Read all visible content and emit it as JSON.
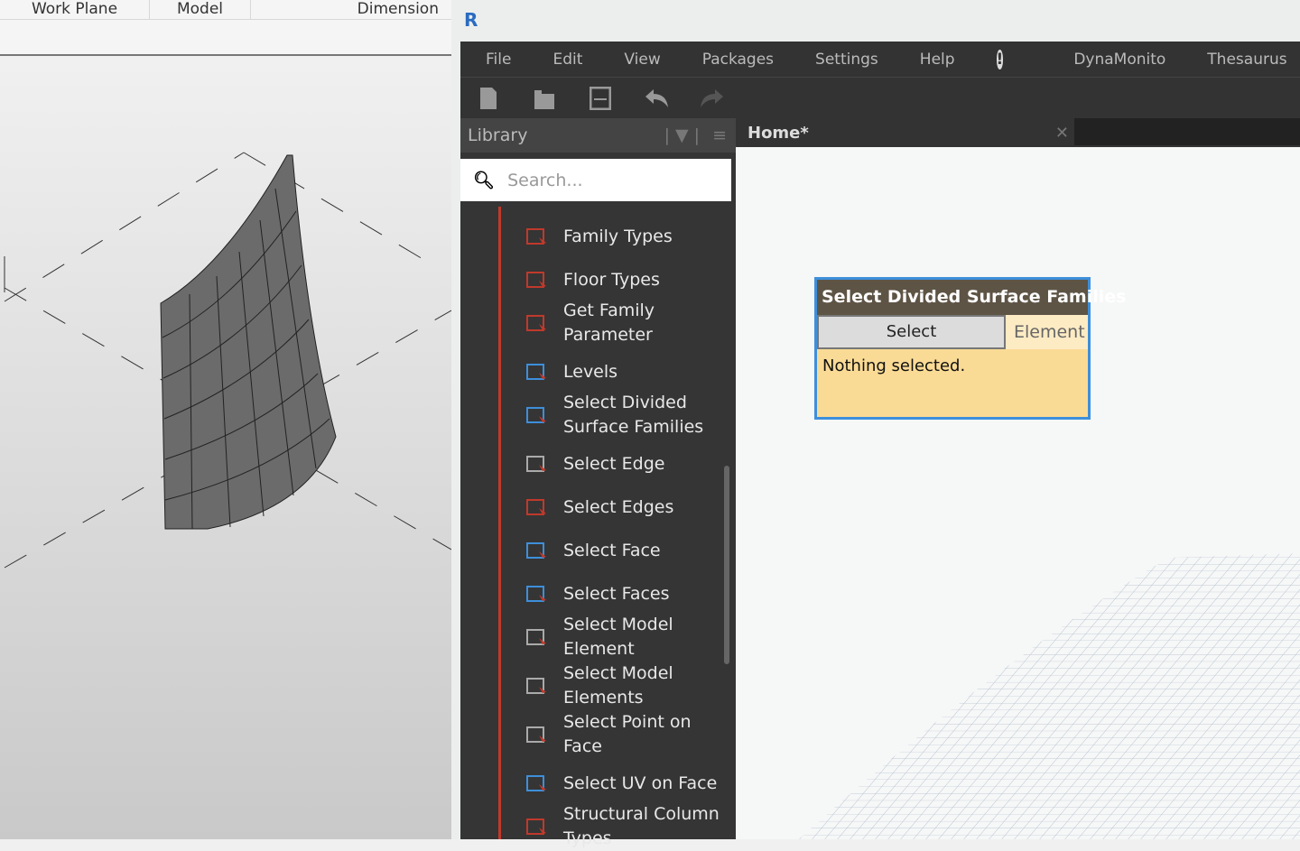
{
  "revit": {
    "ribbon_tabs": [
      "Work Plane",
      "Model",
      "Dimension"
    ]
  },
  "dynamo": {
    "app_icon": "R",
    "menu": [
      "File",
      "Edit",
      "View",
      "Packages",
      "Settings",
      "Help",
      "DynaMonito",
      "Thesaurus"
    ],
    "toolbar_icons": [
      "new-file-icon",
      "open-icon",
      "save-icon",
      "undo-icon",
      "redo-icon"
    ],
    "library": {
      "title": "Library",
      "search_placeholder": "Search...",
      "items": [
        "Family Types",
        "Floor Types",
        "Get Family\nParameter",
        "Levels",
        "Select Divided\nSurface Families",
        "Select Edge",
        "Select Edges",
        "Select Face",
        "Select Faces",
        "Select Model\nElement",
        "Select Model\nElements",
        "Select Point on\nFace",
        "Select UV on Face",
        "Structural Column\nTypes"
      ]
    },
    "tab": {
      "label": "Home*",
      "close": "✕"
    },
    "node": {
      "title": "Select Divided Surface Families",
      "button": "Select",
      "output": "Element",
      "status": "Nothing selected."
    }
  },
  "colors": {
    "accent": "#3d8fdb",
    "node_header": "#5e5445",
    "node_body": "#fadb95",
    "library_line": "#c0392b"
  }
}
